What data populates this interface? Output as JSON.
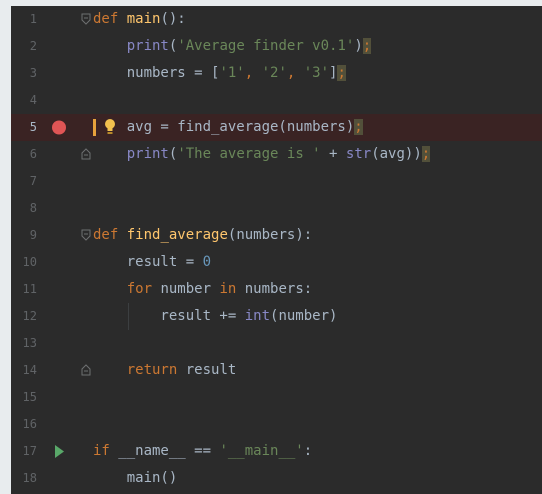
{
  "gutter": {
    "line_numbers": [
      "1",
      "2",
      "3",
      "4",
      "5",
      "6",
      "7",
      "8",
      "9",
      "10",
      "11",
      "12",
      "13",
      "14",
      "15",
      "16",
      "17",
      "18"
    ]
  },
  "code": {
    "l1": {
      "kw": "def",
      "sp": " ",
      "fn": "main",
      "rest": "():"
    },
    "l2": {
      "indent": "    ",
      "bi": "print",
      "p1": "(",
      "str": "'Average finder v0.1'",
      "p2": ")",
      "semi": ";"
    },
    "l3": {
      "text": "    numbers = [",
      "s1": "'1'",
      "c1": ", ",
      "s2": "'2'",
      "c2": ", ",
      "s3": "'3'",
      "close": "]",
      "semi": ";"
    },
    "l5": {
      "text": "    avg = find_average(numbers)",
      "semi": ";"
    },
    "l6": {
      "indent": "    ",
      "bi": "print",
      "p1": "(",
      "str": "'The average is '",
      "plus": " + ",
      "bi2": "str",
      "rest": "(avg))",
      "semi": ";"
    },
    "l9": {
      "kw": "def",
      "sp": " ",
      "fn": "find_average",
      "rest": "(numbers):"
    },
    "l10": {
      "text": "    result = ",
      "num": "0"
    },
    "l11": {
      "indent": "    ",
      "kw": "for",
      "mid": " number ",
      "kw2": "in",
      "rest": " numbers:"
    },
    "l12": {
      "text": "        result += ",
      "bi": "int",
      "rest": "(number)"
    },
    "l14": {
      "indent": "    ",
      "kw": "return",
      "rest": " result"
    },
    "l17": {
      "kw": "if",
      "mid": " __name__ == ",
      "str": "'__main__'",
      "rest": ":"
    },
    "l18": {
      "text": "    main()"
    }
  },
  "colors": {
    "background": "#2b2b2b",
    "keyword": "#cc7832",
    "function": "#ffc66d",
    "string": "#6a8759",
    "number": "#6897bb",
    "builtin": "#8888c6",
    "breakpoint": "#e05555",
    "run_arrow": "#59a869"
  },
  "icons": {
    "breakpoint": "breakpoint-icon",
    "run": "run-arrow-icon",
    "lightbulb": "lightbulb-icon",
    "fold": "fold-icon"
  }
}
